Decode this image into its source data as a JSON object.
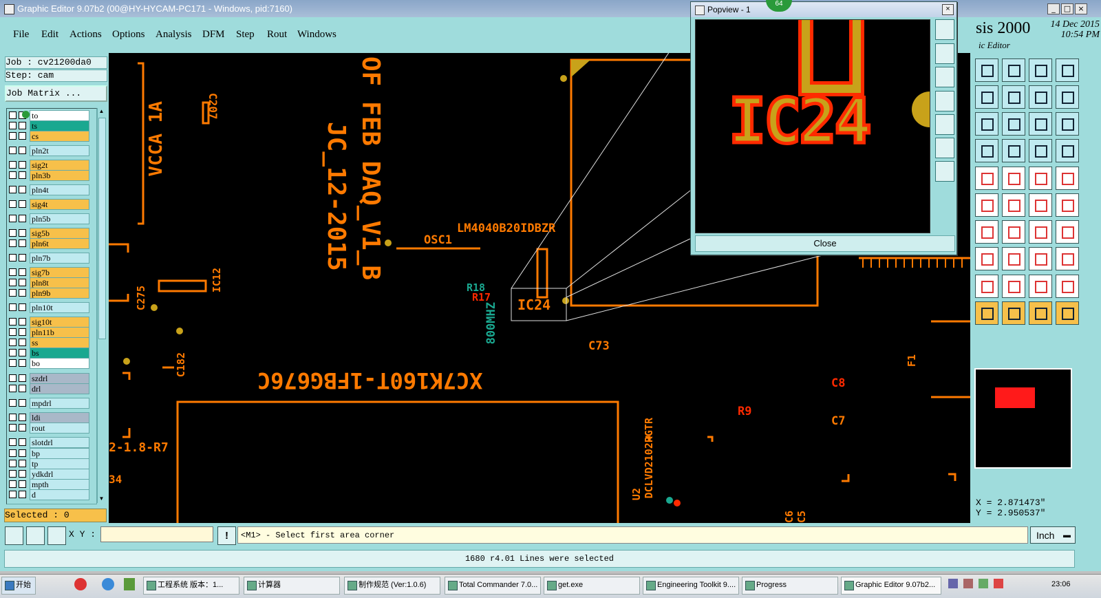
{
  "window": {
    "title": "Graphic Editor 9.07b2 (00@HY-HYCAM-PC171 - Windows, pid:7160)"
  },
  "menu": [
    "File",
    "Edit",
    "Actions",
    "Options",
    "Analysis",
    "DFM",
    "Step",
    "Rout",
    "Windows"
  ],
  "brand": {
    "name": "sis 2000",
    "subtitle": "ic Editor",
    "date": "14 Dec 2015",
    "time": "10:54 PM"
  },
  "job": {
    "job_line": "Job : cv21200da0",
    "step_line": "Step: cam",
    "matrix_button": "Job Matrix ..."
  },
  "layers": [
    {
      "name": "to",
      "color": "#ffffff"
    },
    {
      "name": "ts",
      "color": "#1aa890"
    },
    {
      "name": "cs",
      "color": "#f7c04a"
    },
    {
      "name": "pln2t",
      "color": "#bfeaf0"
    },
    {
      "name": "sig2t",
      "color": "#f7c04a"
    },
    {
      "name": "pln3b",
      "color": "#f7c04a"
    },
    {
      "name": "pln4t",
      "color": "#bfeaf0"
    },
    {
      "name": "sig4t",
      "color": "#f7c04a"
    },
    {
      "name": "pln5b",
      "color": "#bfeaf0"
    },
    {
      "name": "sig5b",
      "color": "#f7c04a"
    },
    {
      "name": "pln6t",
      "color": "#f7c04a"
    },
    {
      "name": "pln7b",
      "color": "#bfeaf0"
    },
    {
      "name": "sig7b",
      "color": "#f7c04a"
    },
    {
      "name": "pln8t",
      "color": "#f7c04a"
    },
    {
      "name": "pln9b",
      "color": "#f7c04a"
    },
    {
      "name": "pln10t",
      "color": "#bfeaf0"
    },
    {
      "name": "sig10t",
      "color": "#f7c04a"
    },
    {
      "name": "pln11b",
      "color": "#f7c04a"
    },
    {
      "name": "ss",
      "color": "#f7c04a"
    },
    {
      "name": "bs",
      "color": "#1aa890"
    },
    {
      "name": "bo",
      "color": "#ffffff"
    },
    {
      "name": "szdrl",
      "color": "#a9b8c8"
    },
    {
      "name": "drl",
      "color": "#a9b8c8"
    },
    {
      "name": "mpdrl",
      "color": "#bfeaf0"
    },
    {
      "name": "ldi",
      "color": "#a9b8c8"
    },
    {
      "name": "rout",
      "color": "#bfeaf0"
    },
    {
      "name": "slotdrl",
      "color": "#bfeaf0"
    },
    {
      "name": "bp",
      "color": "#bfeaf0"
    },
    {
      "name": "tp",
      "color": "#bfeaf0"
    },
    {
      "name": "ydkdrl",
      "color": "#bfeaf0"
    },
    {
      "name": "mpth",
      "color": "#bfeaf0"
    },
    {
      "name": "d",
      "color": "#bfeaf0"
    }
  ],
  "selected": "Selected : 0",
  "canvas_labels": {
    "l1": "OF FEB DAQ_V1_B",
    "l2": "JC_12-2015",
    "l3": "VCCA 1A",
    "l4": "C207",
    "l5": "LM4040B20IDBZR",
    "l6": "OSC1",
    "l7": "R18",
    "l8": "R17",
    "l9": "IC24",
    "l10": "800MHZ",
    "l11": "C73",
    "l12": "XC7K160T-1FBG676C",
    "l13": "C275",
    "l14": "IC12",
    "l15": "C182",
    "l16": "2-1.8-R7",
    "l17": "DCLVD2102RGTR",
    "l18": "U2",
    "l19": "C8",
    "l20": "R9",
    "l21": "C7",
    "l22": "F1",
    "l23": "C6 C5",
    "l24": "34"
  },
  "popview": {
    "title": "Popview - 1",
    "label": "IC24",
    "close": "Close",
    "zoom": "64"
  },
  "coords": {
    "x": "X = 2.871473\"",
    "y": "Y = 2.950537\""
  },
  "command": {
    "xy_label": "X Y :",
    "xy_value": "",
    "prompt": "<M1> - Select first area corner",
    "unit": "Inch"
  },
  "status": "1680 r4.01 Lines were selected",
  "taskbar": [
    "开始",
    "工程系统  版本：1...",
    "计算器",
    "制作规范 (Ver:1.0.6)",
    "Total Commander 7.0...",
    "get.exe",
    "Engineering Toolkit 9....",
    "Progress",
    "Graphic Editor 9.07b2..."
  ],
  "clock": "23:06",
  "colors": {
    "pcb_orange": "#ff7a00",
    "pcb_red": "#ff2a00",
    "pad_gold": "#c8a21a",
    "panel_cyan": "#9fdcdc"
  }
}
